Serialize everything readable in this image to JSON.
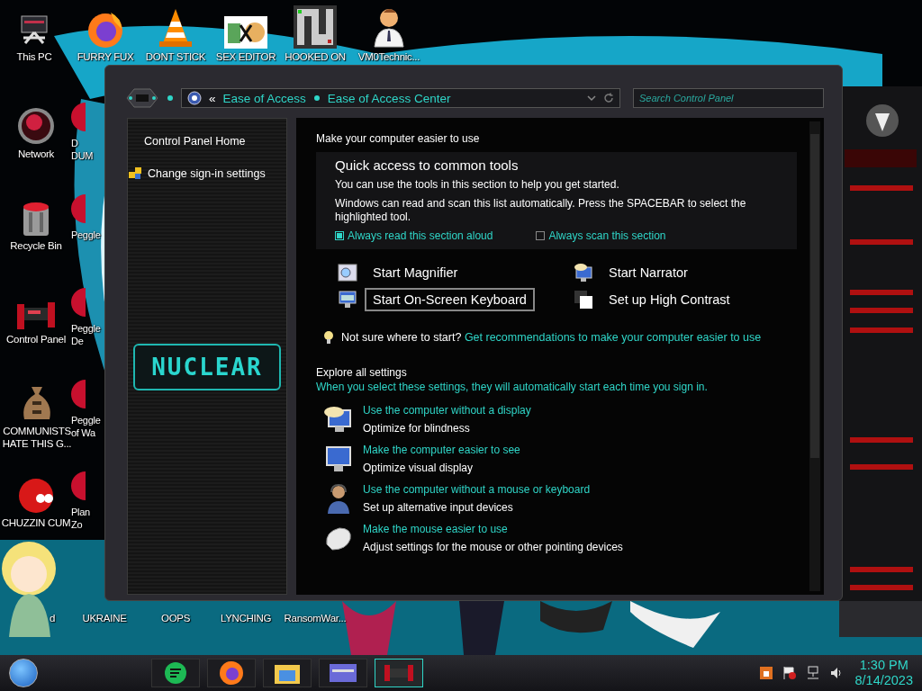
{
  "desktop_icons": [
    {
      "label": "This PC",
      "kind": "full"
    },
    {
      "label": "FURRY FUX",
      "kind": "full"
    },
    {
      "label": "DONT STICK",
      "kind": "full"
    },
    {
      "label": "SEX EDITOR",
      "kind": "full"
    },
    {
      "label": "HOOKED ON",
      "kind": "full"
    },
    {
      "label": "VM0Technic...",
      "kind": "full"
    },
    {
      "label": "Network",
      "kind": "full"
    },
    {
      "label": "Recycle Bin",
      "kind": "full"
    },
    {
      "label": "Control Panel",
      "kind": "full"
    },
    {
      "label": "COMMUNISTS HATE THIS G...",
      "kind": "full"
    },
    {
      "label": "CHUZZIN CUM",
      "kind": "full"
    },
    {
      "label": "D\nDUM",
      "kind": "clipped"
    },
    {
      "label": "Peggle",
      "kind": "clipped"
    },
    {
      "label": "Peggle\nDe",
      "kind": "clipped"
    },
    {
      "label": "Peggle\nof Wa",
      "kind": "clipped"
    },
    {
      "label": "Plan\nZo",
      "kind": "clipped"
    },
    {
      "label": "d",
      "kind": "covered"
    },
    {
      "label": "UKRAINE",
      "kind": "covered"
    },
    {
      "label": "OOPS",
      "kind": "covered"
    },
    {
      "label": "LYNCHING",
      "kind": "covered"
    },
    {
      "label": "RansomWar...",
      "kind": "covered"
    }
  ],
  "window": {
    "address_bar": {
      "prefix": "«",
      "breadcrumbs": [
        "Ease of Access",
        "Ease of Access Center"
      ]
    },
    "search": {
      "placeholder": "Search Control Panel"
    },
    "sidebar": {
      "items": [
        "Control Panel Home",
        "Change sign-in settings"
      ],
      "logo": "NUCLEAR"
    },
    "content": {
      "heading": "Make your computer easier to use",
      "quick_access": {
        "title": "Quick access to common tools",
        "lines": [
          "You can use the tools in this section to help you get started.",
          "Windows can read and scan this list automatically.  Press the SPACEBAR to select the highlighted tool."
        ],
        "checkboxes": [
          {
            "label": "Always read this section aloud",
            "checked": true
          },
          {
            "label": "Always scan this section",
            "checked": false
          }
        ],
        "tools": [
          {
            "label": "Start Magnifier",
            "selected": false
          },
          {
            "label": "Start Narrator",
            "selected": false
          },
          {
            "label": "Start On-Screen Keyboard",
            "selected": true
          },
          {
            "label": "Set up High Contrast",
            "selected": false
          }
        ],
        "tip": {
          "text": "Not sure where to start?",
          "link": "Get recommendations to make your computer easier to use"
        }
      },
      "explore": {
        "title": "Explore all settings",
        "subtitle": "When you select these settings, they will automatically start each time you sign in.",
        "items": [
          {
            "link": "Use the computer without a display",
            "description": "Optimize for blindness"
          },
          {
            "link": "Make the computer easier to see",
            "description": "Optimize visual display"
          },
          {
            "link": "Use the computer without a mouse or keyboard",
            "description": "Set up alternative input devices"
          },
          {
            "link": "Make the mouse easier to use",
            "description": "Adjust settings for the mouse or other pointing devices"
          }
        ]
      }
    }
  },
  "taskbar": {
    "apps": [
      {
        "selected": false
      },
      {
        "selected": false
      },
      {
        "selected": false
      },
      {
        "selected": false
      },
      {
        "selected": true
      }
    ],
    "clock": {
      "time": "1:30 PM",
      "date": "8/14/2023"
    }
  }
}
